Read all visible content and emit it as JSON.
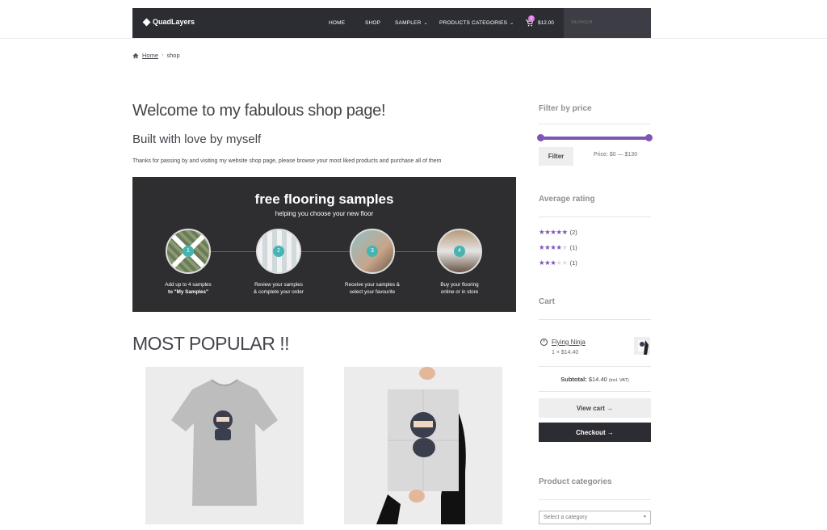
{
  "header": {
    "logo": "QuadLayers",
    "menu": [
      {
        "label": "HOME"
      },
      {
        "label": "SHOP"
      },
      {
        "label": "SAMPLER",
        "dropdown": true
      },
      {
        "label": "PRODUCTS CATEGORIES",
        "dropdown": true
      }
    ],
    "cart_count": "1",
    "cart_amount": "$12.00",
    "search_placeholder": "SEARCH"
  },
  "breadcrumb": {
    "home": "Home",
    "sep": "›",
    "current": "shop"
  },
  "main": {
    "title": "Welcome to my fabulous shop page!",
    "subtitle": "Built with love by myself",
    "intro": "Thanks for passing by and visiting my website shop page, please browse your most liked products and purchase all of them",
    "banner": {
      "title": "free flooring samples",
      "subtitle": "helping you choose your new floor",
      "steps": [
        {
          "num": "1",
          "line1": "Add up to 4 samples",
          "line2": "to \"My Samples\""
        },
        {
          "num": "2",
          "line1": "Review your samples",
          "line2": "& complete your order"
        },
        {
          "num": "3",
          "line1": "Receive your samples &",
          "line2": "select your favourite"
        },
        {
          "num": "4",
          "line1": "Buy your flooring",
          "line2": "online or in store"
        }
      ]
    },
    "popular_heading": "MOST POPULAR !!"
  },
  "sidebar": {
    "filter": {
      "title": "Filter by price",
      "button": "Filter",
      "price_label": "Price: $0 — $130",
      "min": 0,
      "max": 130
    },
    "ratings": {
      "title": "Average rating",
      "items": [
        {
          "stars": 5,
          "count": "(2)"
        },
        {
          "stars": 4,
          "count": "(1)"
        },
        {
          "stars": 3,
          "count": "(1)"
        }
      ]
    },
    "cart": {
      "title": "Cart",
      "item_name": "Flying Ninja",
      "item_qty": "1 × $14.40",
      "subtotal_label": "Subtotal:",
      "subtotal_value": "$14.40",
      "vat_note": "(incl. VAT)",
      "view_cart": "View cart →",
      "checkout": "Checkout →"
    },
    "categories": {
      "title": "Product categories",
      "placeholder": "Select a category"
    }
  },
  "colors": {
    "nav_bg": "#2c2d33",
    "accent": "#7f54b3",
    "badge": "#e57ae8",
    "step_num": "#45b4b2"
  }
}
